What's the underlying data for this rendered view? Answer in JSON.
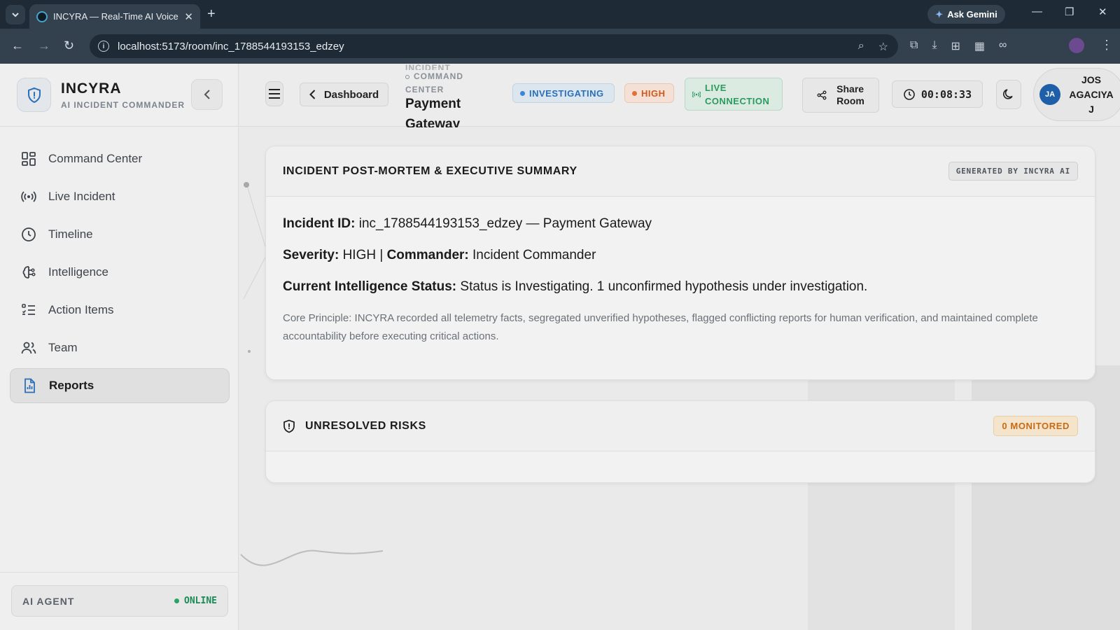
{
  "browser": {
    "tab_title": "INCYRA — Real-Time AI Voice I",
    "url": "localhost:5173/room/inc_1788544193153_edzey",
    "gemini_label": "Ask Gemini"
  },
  "sidebar": {
    "brand_name": "INCYRA",
    "brand_sub": "AI INCIDENT COMMANDER",
    "items": [
      {
        "label": "Command Center",
        "icon": "grid-icon"
      },
      {
        "label": "Live Incident",
        "icon": "broadcast-icon"
      },
      {
        "label": "Timeline",
        "icon": "clock-icon"
      },
      {
        "label": "Intelligence",
        "icon": "brain-icon"
      },
      {
        "label": "Action Items",
        "icon": "checklist-icon"
      },
      {
        "label": "Team",
        "icon": "users-icon"
      },
      {
        "label": "Reports",
        "icon": "report-icon",
        "active": true
      }
    ],
    "agent_label": "AI AGENT",
    "agent_status": "ONLINE"
  },
  "header": {
    "dashboard_label": "Dashboard",
    "crumb_line1": "INCIDENT",
    "crumb_line2": "COMMAND",
    "crumb_line3": "CENTER",
    "title_line1": "Payment",
    "title_line2": "Gateway",
    "status_badge": "INVESTIGATING",
    "severity_badge": "HIGH",
    "live_line1": "LIVE",
    "live_line2": "CONNECTION",
    "share_line1": "Share",
    "share_line2": "Room",
    "timer": "00:08:33",
    "user_initials": "JA",
    "user_line1": "JOS",
    "user_line2": "AGACIYA",
    "user_line3": "J"
  },
  "summary": {
    "title": "INCIDENT POST-MORTEM & EXECUTIVE SUMMARY",
    "generated_badge": "GENERATED BY INCYRA AI",
    "incident_id_label": "Incident ID:",
    "incident_id_value": "inc_1788544193153_edzey — Payment Gateway",
    "severity_label": "Severity:",
    "severity_value": "HIGH |",
    "commander_label": "Commander:",
    "commander_value": "Incident Commander",
    "status_label": "Current Intelligence Status:",
    "status_value": "Status is Investigating. 1 unconfirmed hypothesis under investigation.",
    "principle": "Core Principle: INCYRA recorded all telemetry facts, segregated unverified hypotheses, flagged conflicting reports for human verification, and maintained complete accountability before executing critical actions."
  },
  "risks": {
    "title": "UNRESOLVED RISKS",
    "monitored_badge": "0 MONITORED"
  },
  "colors": {
    "accent_blue": "#2a70b8",
    "severity_orange": "#d05a1e",
    "live_green": "#2a9a5e",
    "online_green": "#1a8a55"
  }
}
